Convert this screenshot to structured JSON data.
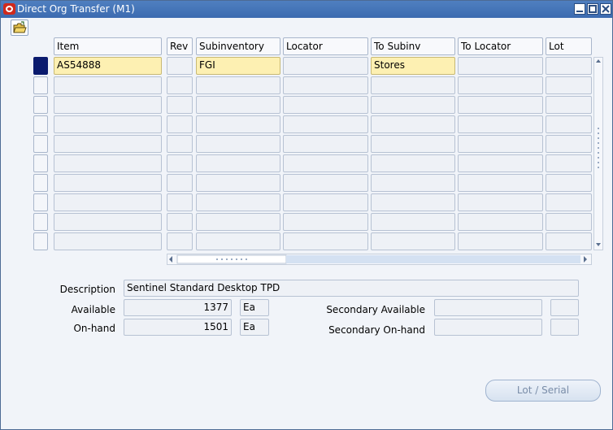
{
  "window": {
    "title": "Direct Org Transfer (M1)"
  },
  "table": {
    "headers": [
      "Item",
      "Rev",
      "Subinventory",
      "Locator",
      "To Subinv",
      "To Locator",
      "Lot"
    ],
    "rows": [
      [
        "AS54888",
        "",
        "FGI",
        "",
        "Stores",
        "",
        ""
      ],
      [
        "",
        "",
        "",
        "",
        "",
        "",
        ""
      ],
      [
        "",
        "",
        "",
        "",
        "",
        "",
        ""
      ],
      [
        "",
        "",
        "",
        "",
        "",
        "",
        ""
      ],
      [
        "",
        "",
        "",
        "",
        "",
        "",
        ""
      ],
      [
        "",
        "",
        "",
        "",
        "",
        "",
        ""
      ],
      [
        "",
        "",
        "",
        "",
        "",
        "",
        ""
      ],
      [
        "",
        "",
        "",
        "",
        "",
        "",
        ""
      ],
      [
        "",
        "",
        "",
        "",
        "",
        "",
        ""
      ],
      [
        "",
        "",
        "",
        "",
        "",
        "",
        ""
      ]
    ]
  },
  "details": {
    "description_label": "Description",
    "description_value": "Sentinel Standard Desktop TPD",
    "available_label": "Available",
    "available_value": "1377",
    "available_uom": "Ea",
    "onhand_label": "On-hand",
    "onhand_value": "1501",
    "onhand_uom": "Ea",
    "secondary_available_label": "Secondary Available",
    "secondary_available_value": "",
    "secondary_available_uom": "",
    "secondary_onhand_label": "Secondary On-hand",
    "secondary_onhand_value": "",
    "secondary_onhand_uom": ""
  },
  "buttons": {
    "lot_serial": "Lot / Serial"
  },
  "icons": {
    "toolbar": "open-folder-icon",
    "app": "oracle-logo-icon"
  },
  "colors": {
    "titlebar": "#3c6bb0",
    "required_field": "#fdf0b2",
    "selected_row": "#0b1b6e"
  }
}
